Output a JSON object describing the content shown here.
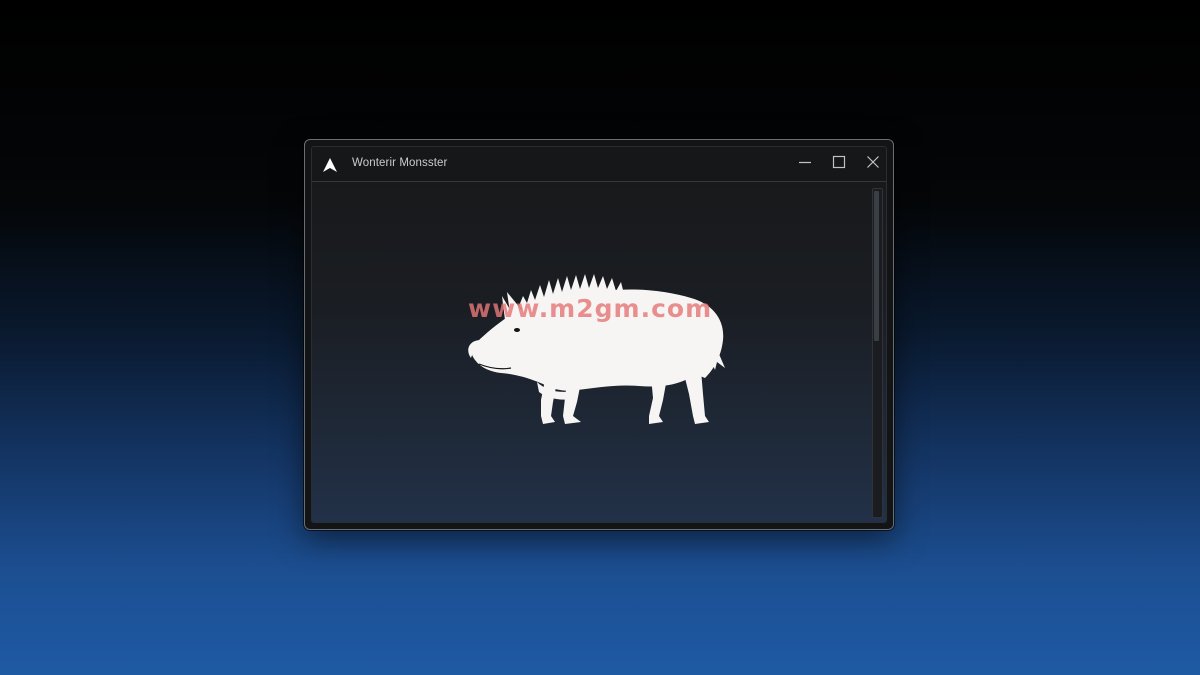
{
  "window": {
    "title": "Wonterir Monsster",
    "app_icon": "arrow-logo-icon",
    "controls": {
      "minimize_icon": "minimize-icon",
      "maximize_icon": "maximize-icon",
      "close_icon": "close-icon"
    }
  },
  "content": {
    "image_subject": "boar-silhouette",
    "watermark_text": "www.m2gm.com"
  },
  "colors": {
    "background_top": "#000000",
    "background_bottom": "#1e5aa4",
    "window_bg": "#131416",
    "silhouette": "#f7f5f3",
    "watermark": "#e47878"
  }
}
